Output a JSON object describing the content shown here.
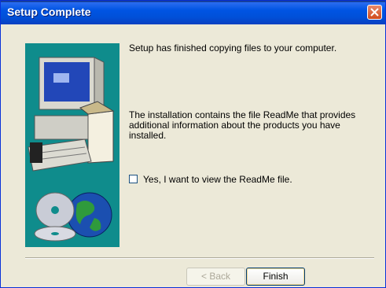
{
  "window": {
    "title": "Setup Complete"
  },
  "content": {
    "message_1": "Setup has finished copying files to your computer.",
    "message_2": "The installation contains the file ReadMe that provides additional information about the products you have installed.",
    "checkbox_label": "Yes, I want to view the ReadMe file.",
    "checkbox_checked": false
  },
  "buttons": {
    "back": "< Back",
    "finish": "Finish"
  },
  "colors": {
    "titlebar": "#0054e3",
    "art_background": "#0f8c8c",
    "dialog_background": "#ece9d8"
  }
}
